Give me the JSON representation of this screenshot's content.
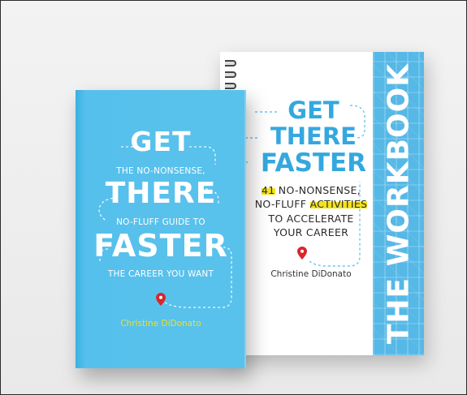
{
  "workbook": {
    "title_line1": "GET",
    "title_line2": "THERE",
    "title_line3": "FASTER",
    "subtitle_line1_prefix": "",
    "subtitle_line1_highlight": "41",
    "subtitle_line1_rest": " NO-NONSENSE,",
    "subtitle_line2_prefix": "NO-FLUFF ",
    "subtitle_line2_highlight": "ACTIVITIES",
    "subtitle_line3": "TO ACCELERATE",
    "subtitle_line4": "YOUR CAREER",
    "author": "Christine DiDonato",
    "spine_title": "THE WORKBOOK"
  },
  "book": {
    "word1": "GET",
    "line1": "THE NO-NONSENSE,",
    "word2": "THERE",
    "line2": "NO-FLUFF GUIDE TO",
    "word3": "FASTER",
    "line3": "THE CAREER YOU WANT",
    "author": "Christine DiDonato"
  },
  "colors": {
    "cover_blue": "#59c2ec",
    "title_blue": "#34a8de",
    "highlight_yellow": "#f4e21a",
    "author_yellow": "#f2e11c",
    "pin_red": "#d9262b"
  },
  "icons": {
    "pin": "map-pin-icon"
  }
}
